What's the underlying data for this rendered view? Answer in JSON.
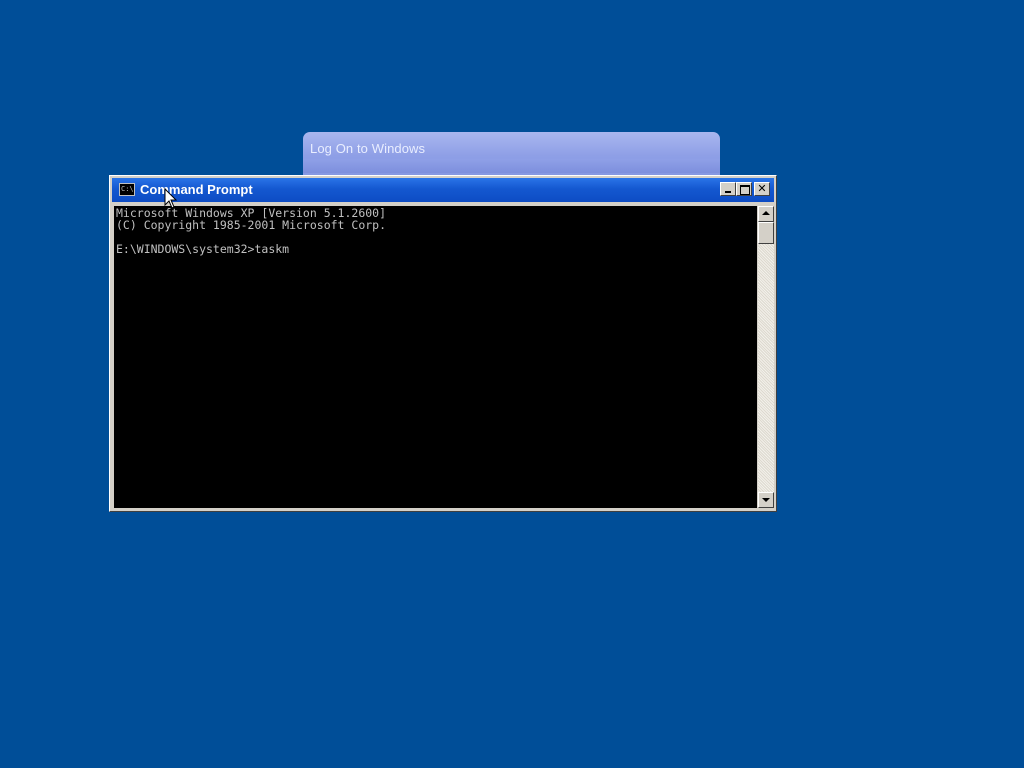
{
  "desktop": {
    "background_color": "#004e98"
  },
  "logon_dialog": {
    "title": "Log On to Windows"
  },
  "cmd_window": {
    "title": "Command Prompt",
    "icon": "console-icon",
    "icon_text": "C:\\",
    "buttons": {
      "minimize": "minimize-icon",
      "maximize": "maximize-icon",
      "close_label": "✕"
    },
    "console_lines": [
      "Microsoft Windows XP [Version 5.1.2600]",
      "(C) Copyright 1985-2001 Microsoft Corp.",
      "",
      "E:\\WINDOWS\\system32>taskm"
    ],
    "scrollbar": {
      "up_icon": "scroll-up-arrow-icon",
      "down_icon": "scroll-down-arrow-icon"
    }
  },
  "cursor": {
    "icon": "mouse-pointer-icon"
  }
}
